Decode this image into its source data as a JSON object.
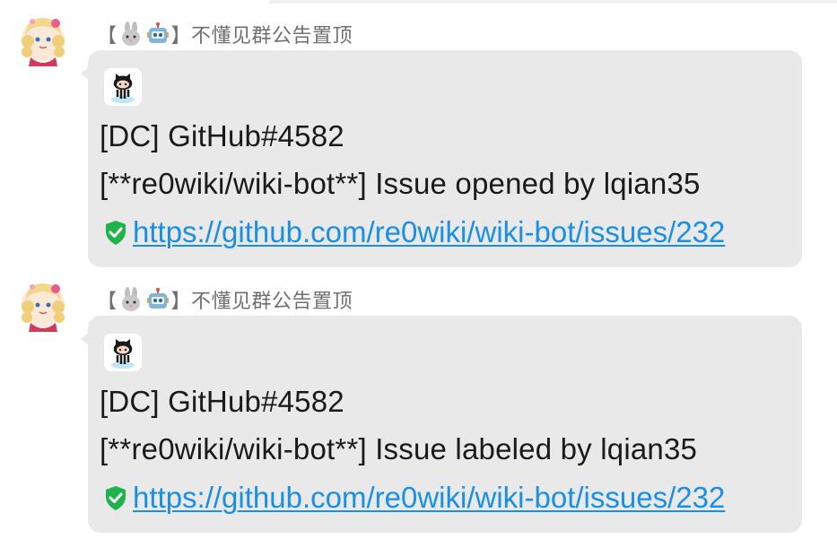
{
  "messages": [
    {
      "sender": {
        "open_bracket": "【",
        "close_bracket": "】",
        "name": "不懂见群公告置顶"
      },
      "lines": {
        "title": "[DC] GitHub#4582",
        "body": "[**re0wiki/wiki-bot**] Issue opened by lqian35",
        "url": "https://github.com/re0wiki/wiki-bot/issues/232"
      }
    },
    {
      "sender": {
        "open_bracket": "【",
        "close_bracket": "】",
        "name": "不懂见群公告置顶"
      },
      "lines": {
        "title": "[DC] GitHub#4582",
        "body": "[**re0wiki/wiki-bot**] Issue labeled by lqian35",
        "url": "https://github.com/re0wiki/wiki-bot/issues/232"
      }
    }
  ],
  "colors": {
    "bubble_bg": "#e9e9e9",
    "link": "#1a8fe6",
    "sender_text": "#6f6f6f",
    "shield_green": "#22b24c"
  },
  "icons": [
    "user-avatar",
    "rabbit-icon",
    "robot-icon",
    "github-octocat-icon",
    "security-shield-icon"
  ]
}
